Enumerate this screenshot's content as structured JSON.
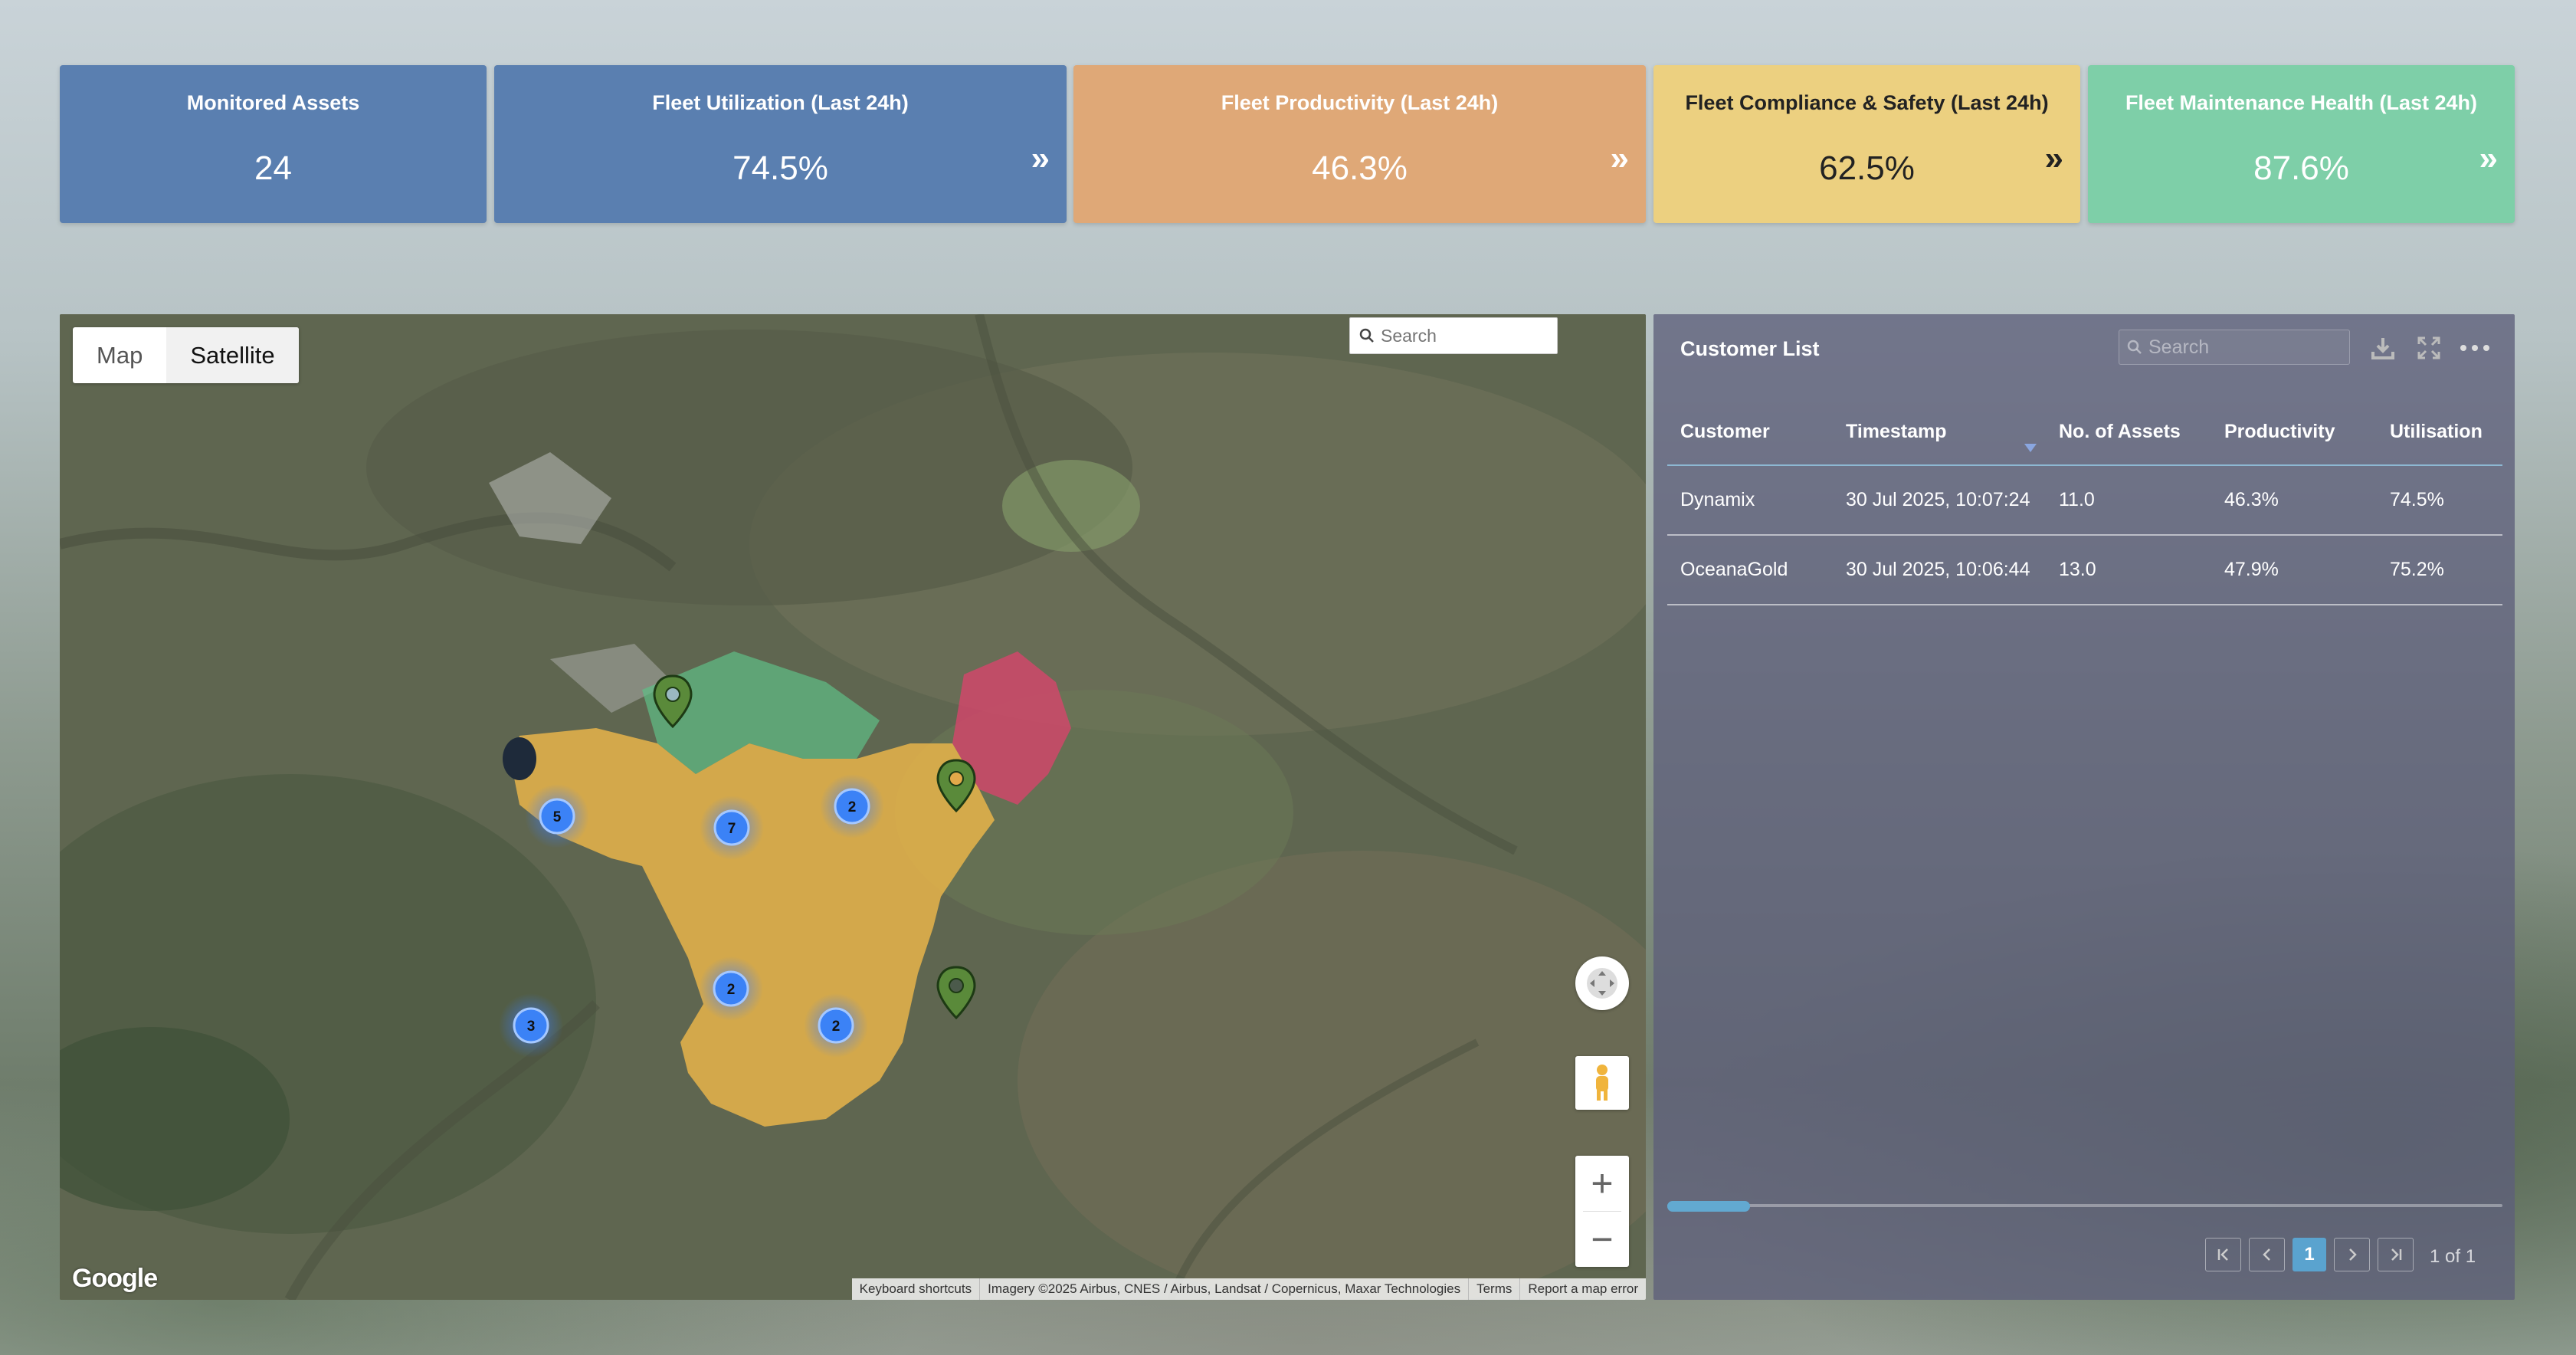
{
  "kpis": [
    {
      "title": "Monitored Assets",
      "value": "24",
      "color": "#5a7fb0"
    },
    {
      "title": "Fleet Utilization (Last 24h)",
      "value": "74.5%",
      "arrow": "»",
      "color": "#5a7fb0"
    },
    {
      "title": "Fleet Productivity (Last 24h)",
      "value": "46.3%",
      "arrow": "»",
      "color": "#dfa877"
    },
    {
      "title": "Fleet Compliance & Safety (Last 24h)",
      "value": "62.5%",
      "arrow": "»",
      "color": "#ecd080"
    },
    {
      "title": "Fleet Maintenance Health (Last 24h)",
      "value": "87.6%",
      "arrow": "»",
      "color": "#7ecfa8"
    }
  ],
  "map": {
    "tabs": [
      "Map",
      "Satellite"
    ],
    "active_tab": "Satellite",
    "search_placeholder": "Search",
    "logo": "Google",
    "clusters": [
      "5",
      "7",
      "2",
      "2",
      "3",
      "2"
    ],
    "zone_colors": {
      "work_area": "#e8b44a",
      "green_zone": "#5fbf86",
      "red_zone": "#d6456b"
    },
    "attribution": [
      "Keyboard shortcuts",
      "Imagery ©2025 Airbus, CNES / Airbus, Landsat / Copernicus, Maxar Technologies",
      "Terms",
      "Report a map error"
    ],
    "controls": [
      "fullscreen-icon",
      "pegman-icon",
      "zoom-in-icon",
      "zoom-out-icon"
    ]
  },
  "customer_list": {
    "title": "Customer List",
    "search_placeholder": "Search",
    "columns": [
      "Customer",
      "Timestamp",
      "No. of Assets",
      "Productivity",
      "Utilisation"
    ],
    "rows": [
      [
        "Dynamix",
        "30 Jul 2025, 10:07:24",
        "11.0",
        "46.3%",
        "74.5%"
      ],
      [
        "OceanaGold",
        "30 Jul 2025, 10:06:44",
        "13.0",
        "47.9%",
        "75.2%"
      ]
    ],
    "pagination": {
      "current": "1",
      "summary": "1 of 1"
    },
    "icons": [
      "download-icon",
      "expand-icon",
      "more-icon"
    ]
  }
}
